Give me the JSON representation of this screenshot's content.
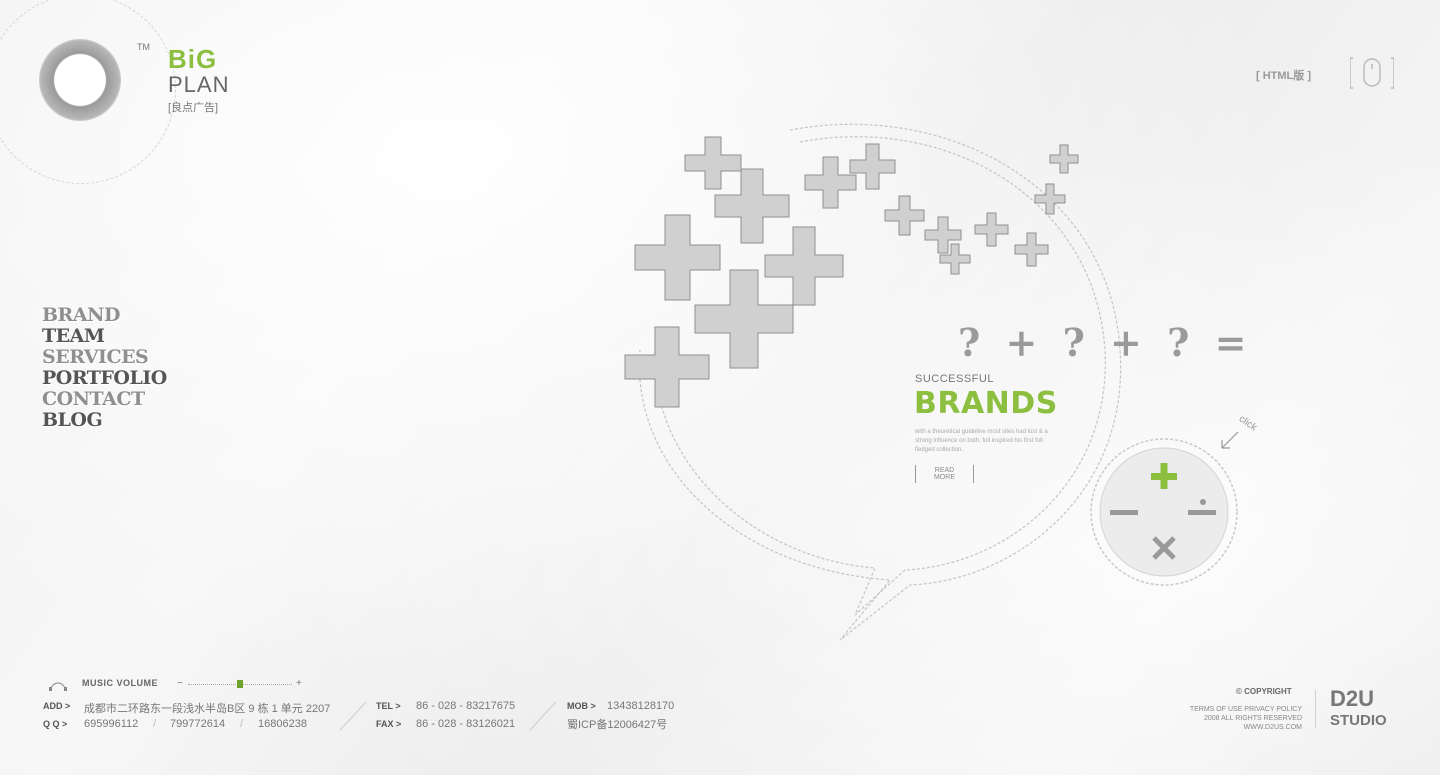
{
  "brand": {
    "tm": "TM",
    "big": "BiG",
    "plan": "PLAN",
    "cn": "[良点广告]"
  },
  "nav": {
    "items": [
      {
        "label": "BRAND"
      },
      {
        "label": "TEAM"
      },
      {
        "label": "SERVICES"
      },
      {
        "label": "PORTFOLIO"
      },
      {
        "label": "CONTACT"
      },
      {
        "label": "BLOG"
      }
    ]
  },
  "top_right": {
    "html_version": "[ HTML版 ]"
  },
  "hero": {
    "equation": "? + ? + ? =",
    "successful": "SUCCESSFUL",
    "brands": "BRANDS",
    "blurb": "with a theoretical guideline most sites had lost & a strong influence on both. full inspired his first full fledged collection.",
    "read_more_1": "READ",
    "read_more_2": "MORE",
    "click": "click"
  },
  "footer": {
    "music_label": "MUSIC VOLUME",
    "music_level": 0.5,
    "add_label": "ADD >",
    "add_value": "成都市二环路东一段浅水半岛B区 9 栋 1 单元 2207",
    "qq_label": "Q Q >",
    "qq_1": "695996112",
    "qq_2": "799772614",
    "qq_3": "16806238",
    "tel_label": "TEL >",
    "tel_value": "86 - 028 - 83217675",
    "fax_label": "FAX >",
    "fax_value": "86 - 028 - 83126021",
    "mob_label": "MOB >",
    "mob_value": "13438128170",
    "icp": "蜀ICP备12006427号",
    "copyright": "© COPYRIGHT",
    "terms_1": "TERMS OF USE PRIVACY POLICY",
    "terms_2": "2008 ALL RIGHTS RESERVED",
    "terms_3": "WWW.D2US.COM",
    "studio_top": "D2U",
    "studio_bottom": "STUDIO"
  },
  "colors": {
    "accent": "#8cbf3f",
    "text": "#555555",
    "muted": "#999999"
  }
}
